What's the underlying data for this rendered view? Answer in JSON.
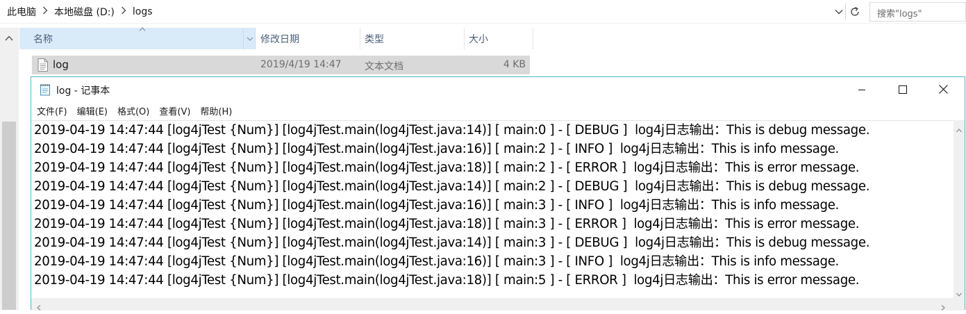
{
  "explorer": {
    "breadcrumb": [
      "此电脑",
      "本地磁盘 (D:)",
      "logs"
    ],
    "search_placeholder": "搜索\"logs\"",
    "columns": {
      "name": "名称",
      "date": "修改日期",
      "type": "类型",
      "size": "大小"
    },
    "files": [
      {
        "name": "log",
        "date": "2019/4/19 14:47",
        "type": "文本文档",
        "size": "4 KB"
      }
    ]
  },
  "notepad": {
    "title": "log - 记事本",
    "menu": [
      "文件(F)",
      "编辑(E)",
      "格式(O)",
      "查看(V)",
      "帮助(H)"
    ],
    "lines": [
      "2019-04-19 14:47:44 [log4jTest {Num}] [log4jTest.main(log4jTest.java:14)] [ main:0 ] - [ DEBUG ]  log4j日志输出：This is debug message.",
      "2019-04-19 14:47:44 [log4jTest {Num}] [log4jTest.main(log4jTest.java:16)] [ main:2 ] - [ INFO ]  log4j日志输出：This is info message.",
      "2019-04-19 14:47:44 [log4jTest {Num}] [log4jTest.main(log4jTest.java:18)] [ main:2 ] - [ ERROR ]  log4j日志输出：This is error message.",
      "2019-04-19 14:47:44 [log4jTest {Num}] [log4jTest.main(log4jTest.java:14)] [ main:2 ] - [ DEBUG ]  log4j日志输出：This is debug message.",
      "2019-04-19 14:47:44 [log4jTest {Num}] [log4jTest.main(log4jTest.java:16)] [ main:3 ] - [ INFO ]  log4j日志输出：This is info message.",
      "2019-04-19 14:47:44 [log4jTest {Num}] [log4jTest.main(log4jTest.java:18)] [ main:3 ] - [ ERROR ]  log4j日志输出：This is error message.",
      "2019-04-19 14:47:44 [log4jTest {Num}] [log4jTest.main(log4jTest.java:14)] [ main:3 ] - [ DEBUG ]  log4j日志输出：This is debug message.",
      "2019-04-19 14:47:44 [log4jTest {Num}] [log4jTest.main(log4jTest.java:16)] [ main:3 ] - [ INFO ]  log4j日志输出：This is info message.",
      "2019-04-19 14:47:44 [log4jTest {Num}] [log4jTest.main(log4jTest.java:18)] [ main:5 ] - [ ERROR ]  log4j日志输出：This is error message."
    ]
  },
  "icons": {
    "breadcrumb_separator": "chevron-right-icon",
    "address_dropdown": "chevron-down-icon",
    "refresh": "refresh-icon",
    "file": "text-file-icon",
    "notepad": "notepad-icon",
    "minimize": "minimize-icon",
    "maximize": "maximize-icon",
    "close": "close-icon"
  },
  "colors": {
    "header_selected": "#d9ebf9",
    "row_selected": "#d9d9d9",
    "window_border": "#48b8c6",
    "header_text": "#4c607a"
  }
}
